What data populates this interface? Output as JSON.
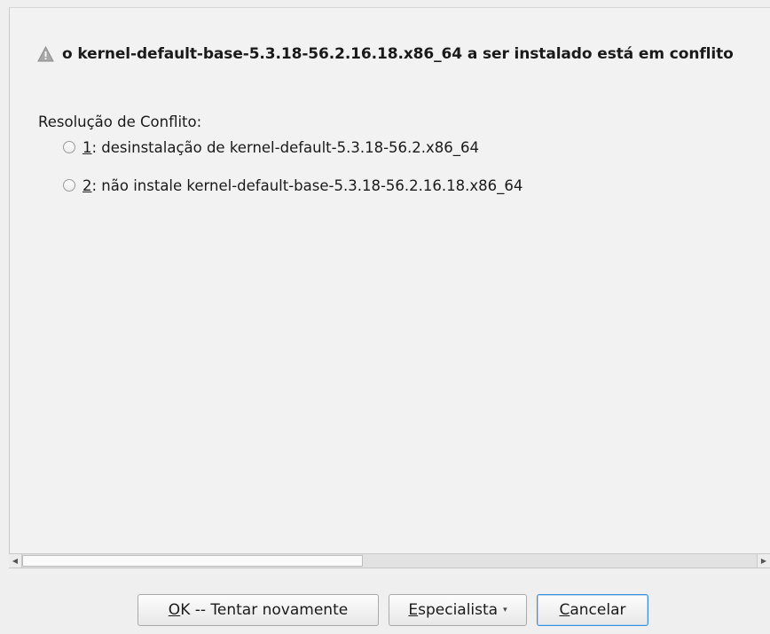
{
  "conflict": {
    "icon": "warning-triangle-icon",
    "message": "o kernel-default-base-5.3.18-56.2.16.18.x86_64 a ser instalado está em conflito"
  },
  "resolution": {
    "label": "Resolução de Conflito:",
    "options": [
      {
        "key": "1",
        "text": ": desinstalação de kernel-default-5.3.18-56.2.x86_64",
        "selected": false
      },
      {
        "key": "2",
        "text": ": não instale kernel-default-base-5.3.18-56.2.16.18.x86_64",
        "selected": false
      }
    ]
  },
  "scrollbar": {
    "left_arrow": "◀",
    "right_arrow": "▶"
  },
  "buttons": {
    "ok": {
      "mnemonic": "O",
      "rest": "K -- Tentar novamente"
    },
    "expert": {
      "mnemonic": "E",
      "rest": "specialista",
      "caret": "▾"
    },
    "cancel": {
      "mnemonic": "C",
      "rest": "ancelar"
    }
  }
}
